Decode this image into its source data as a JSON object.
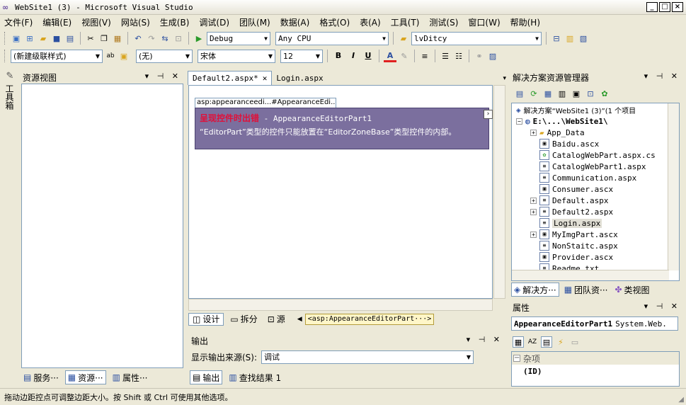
{
  "window": {
    "title": "WebSite1 (3) - Microsoft Visual Studio",
    "logo": "∞"
  },
  "menu": [
    "文件(F)",
    "编辑(E)",
    "视图(V)",
    "网站(S)",
    "生成(B)",
    "调试(D)",
    "团队(M)",
    "数据(A)",
    "格式(O)",
    "表(A)",
    "工具(T)",
    "测试(S)",
    "窗口(W)",
    "帮助(H)"
  ],
  "toolbar1": {
    "config": "Debug",
    "platform": "Any CPU",
    "find": "lvDitcy"
  },
  "toolbar2": {
    "style": "(新建级联样式)",
    "block": "(无)",
    "font": "宋体",
    "size": "12",
    "bold": "B",
    "italic": "I",
    "underline": "U",
    "font_color": "A"
  },
  "side_strip": {
    "label": "工具箱"
  },
  "left_panel": {
    "title": "资源视图"
  },
  "doc_tabs": [
    {
      "label": "Default2.aspx*"
    },
    {
      "label": "Login.aspx"
    }
  ],
  "designer": {
    "control_header": "asp:appearanceedi...#AppearanceEdi...",
    "error_title": "呈现控件时出错",
    "control_name": " - AppearanceEditorPart1",
    "error_message": "“EditorPart”类型的控件只能放置在“EditorZoneBase”类型控件的内部。"
  },
  "view_tabs": [
    {
      "label": "设计"
    },
    {
      "label": "拆分"
    },
    {
      "label": "源"
    }
  ],
  "breadcrumb": "<asp:AppearanceEditorPart···>",
  "output_panel": {
    "title": "输出",
    "source_label": "显示输出来源(S):",
    "source_value": "调试"
  },
  "bottom_tabs_center": [
    {
      "label": "输出"
    },
    {
      "label": "查找结果 1"
    }
  ],
  "bottom_tabs_left": [
    {
      "label": "服务···"
    },
    {
      "label": "资源···"
    },
    {
      "label": "属性···"
    }
  ],
  "solution_explorer": {
    "title": "解决方案资源管理器",
    "solution": "解决方案“WebSite1 (3)”(1 个项目",
    "project": "E:\\...\\WebSite1\\",
    "items": [
      "App_Data",
      "Baidu.ascx",
      "CatalogWebPart.aspx.cs",
      "CatalogWebPart1.aspx",
      "Communication.aspx",
      "Consumer.ascx",
      "Default.aspx",
      "Default2.aspx",
      "Login.aspx",
      "MyImgPart.ascx",
      "NonStaitc.aspx",
      "Provider.ascx",
      "Readme.txt"
    ]
  },
  "right_tabs": [
    {
      "label": "解决方···"
    },
    {
      "label": "团队资···"
    },
    {
      "label": "类视图"
    }
  ],
  "properties": {
    "title": "属性",
    "object": "AppearanceEditorPart1",
    "object_type": "System.Web.",
    "category": "杂项",
    "first_prop": "(ID)"
  },
  "status": "拖动边距控点可调整边距大小。按 Shift 或 Ctrl 可使用其他选项。"
}
